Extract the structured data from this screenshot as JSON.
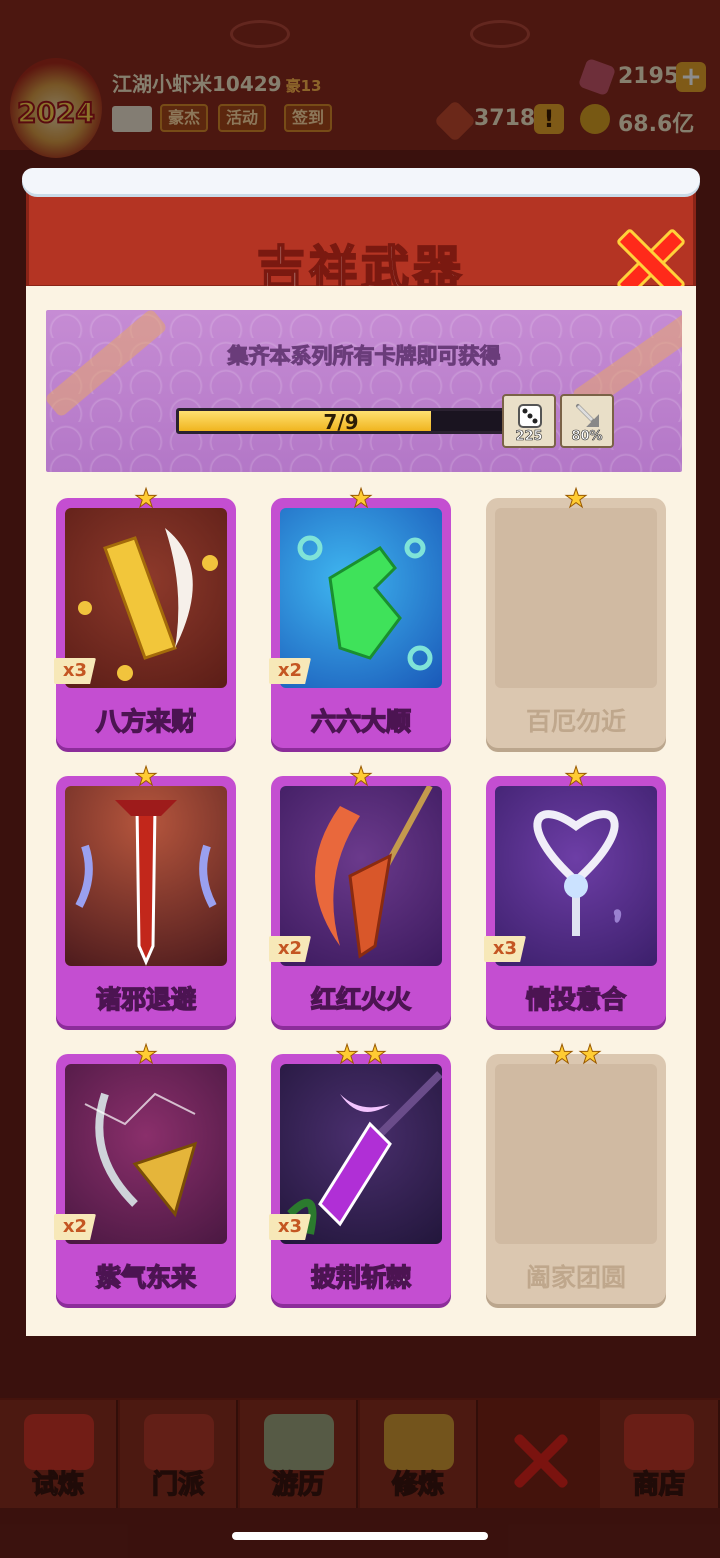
{
  "hud": {
    "player_name": "江湖小虾米10429",
    "rank": "豪13",
    "avatar_year": "2024",
    "btn_hero": "豪杰",
    "btn_activity": "活动",
    "btn_signin": "签到",
    "gems": "2195",
    "tokens": "3718",
    "coins": "68.6亿",
    "plus_icon": "plus-icon",
    "alert_icon": "exclamation-icon"
  },
  "dialog": {
    "title": "吉祥武器",
    "close_icon": "close-icon",
    "banner_text": "集齐本系列所有卡牌即可获得",
    "progress": {
      "current": 7,
      "total": 9,
      "label": "7/9"
    },
    "rewards": [
      {
        "icon": "dice-icon",
        "value": "225"
      },
      {
        "icon": "sword-icon",
        "value": "80%"
      }
    ]
  },
  "cards": [
    {
      "label": "八方来财",
      "count": "x3",
      "stars": 1,
      "owned": true,
      "art": "gold-blade"
    },
    {
      "label": "六六大顺",
      "count": "x2",
      "stars": 1,
      "owned": true,
      "art": "green-hand"
    },
    {
      "label": "百厄勿近",
      "count": "",
      "stars": 1,
      "owned": false,
      "art": "locked"
    },
    {
      "label": "诸邪退避",
      "count": "",
      "stars": 1,
      "owned": true,
      "art": "red-sword"
    },
    {
      "label": "红红火火",
      "count": "x2",
      "stars": 1,
      "owned": true,
      "art": "fire-spear"
    },
    {
      "label": "情投意合",
      "count": "x3",
      "stars": 1,
      "owned": true,
      "art": "heart-key"
    },
    {
      "label": "紫气东来",
      "count": "x2",
      "stars": 1,
      "owned": true,
      "art": "purple-bow"
    },
    {
      "label": "披荆斩棘",
      "count": "x3",
      "stars": 2,
      "owned": true,
      "art": "thorn-spear"
    },
    {
      "label": "阖家团圆",
      "count": "",
      "stars": 2,
      "owned": false,
      "art": "locked"
    }
  ],
  "bottom_nav": [
    {
      "label": "试炼",
      "icon": "firecracker-icon"
    },
    {
      "label": "门派",
      "icon": "temple-icon"
    },
    {
      "label": "游历",
      "icon": "cloud-mountain-icon"
    },
    {
      "label": "修炼",
      "icon": "book-icon"
    },
    {
      "label": "",
      "icon": "close-icon"
    },
    {
      "label": "商店",
      "icon": "shop-icon"
    }
  ],
  "colors": {
    "header_red": "#b43423",
    "card_purple": "#c44ed1",
    "locked_card": "#dbc7b0",
    "progress_fill": "#f0b51f",
    "star": "#ffcc33"
  }
}
